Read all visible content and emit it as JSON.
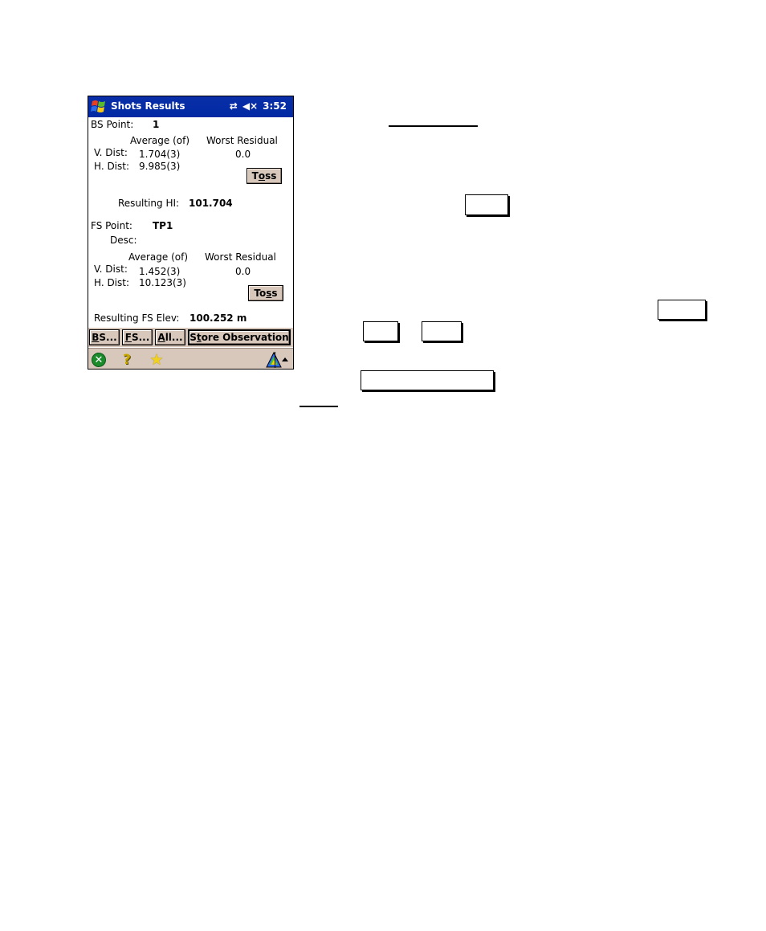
{
  "device": {
    "titlebar": {
      "title": "Shots Results",
      "status_icons": [
        "connectivity-icon",
        "speaker-muted-icon"
      ],
      "time": "3:52",
      "connectivity_glyph": "⇄",
      "speaker_glyph": "◀×"
    },
    "bs": {
      "point_label": "BS Point:",
      "point_value": "1",
      "avg_header": "Average (of)",
      "residual_header": "Worst Residual",
      "vdist_label": "V. Dist:",
      "vdist_value": "1.704(3)",
      "vdist_residual": "0.0",
      "hdist_label": "H. Dist:",
      "hdist_value": "9.985(3)",
      "toss_prefix": "T",
      "toss_accel": "o",
      "toss_suffix": "ss"
    },
    "resulting_hi": {
      "label": "Resulting HI:",
      "value": "101.704"
    },
    "fs": {
      "point_label": "FS Point:",
      "point_value": "TP1",
      "desc_label": "Desc:",
      "desc_value": "",
      "avg_header": "Average (of)",
      "residual_header": "Worst Residual",
      "vdist_label": "V. Dist:",
      "vdist_value": "1.452(3)",
      "vdist_residual": "0.0",
      "hdist_label": "H. Dist:",
      "hdist_value": "10.123(3)",
      "toss_prefix": "To",
      "toss_accel": "s",
      "toss_suffix": "s"
    },
    "resulting_fs": {
      "label": "Resulting FS Elev:",
      "value": "100.252 m"
    },
    "buttons": {
      "bs": {
        "accel": "B",
        "rest": "S..."
      },
      "fs": {
        "accel": "F",
        "rest": "S..."
      },
      "all": {
        "accel": "A",
        "rest": "ll..."
      },
      "store": {
        "prefix": "S",
        "accel": "t",
        "rest": "ore Observation"
      }
    },
    "taskbar": {
      "close_glyph": "✕",
      "help_glyph": "?",
      "favorites_glyph": "★",
      "input_arrow": "▲"
    }
  },
  "colors": {
    "titlebar": "#0029a3",
    "chrome": "#d8c8bc",
    "close_green": "#1a8a2a"
  }
}
